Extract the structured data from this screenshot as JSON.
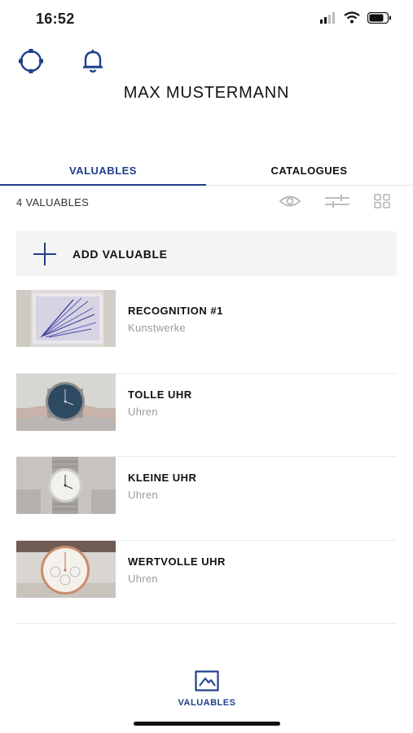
{
  "status_bar": {
    "time": "16:52",
    "icons": [
      "signal-icon",
      "wifi-icon",
      "battery-icon"
    ]
  },
  "header": {
    "icons": [
      "settings-icon",
      "bell-icon"
    ],
    "profile_name": "MAX MUSTERMANN"
  },
  "tabs": [
    {
      "label": "VALUABLES",
      "active": true
    },
    {
      "label": "CATALOGUES",
      "active": false
    }
  ],
  "toolbar": {
    "count_label": "4 VALUABLES",
    "icons": [
      "eye-icon",
      "filter-sliders-icon",
      "grid-view-icon"
    ]
  },
  "add_valuable": {
    "label": "ADD VALUABLE",
    "icon": "plus-icon"
  },
  "valuables": [
    {
      "title": "RECOGNITION #1",
      "category": "Kunstwerke",
      "thumb": "artwork"
    },
    {
      "title": "TOLLE UHR",
      "category": "Uhren",
      "thumb": "watch-blue"
    },
    {
      "title": "KLEINE UHR",
      "category": "Uhren",
      "thumb": "watch-silver"
    },
    {
      "title": "WERTVOLLE UHR",
      "category": "Uhren",
      "thumb": "watch-rose"
    }
  ],
  "bottom_nav": {
    "label": "VALUABLES",
    "icon": "valuables-mountain-icon"
  },
  "colors": {
    "accent": "#1f3f8a",
    "muted_text": "#9a9a9a",
    "add_row_bg": "#f4f4f4"
  }
}
